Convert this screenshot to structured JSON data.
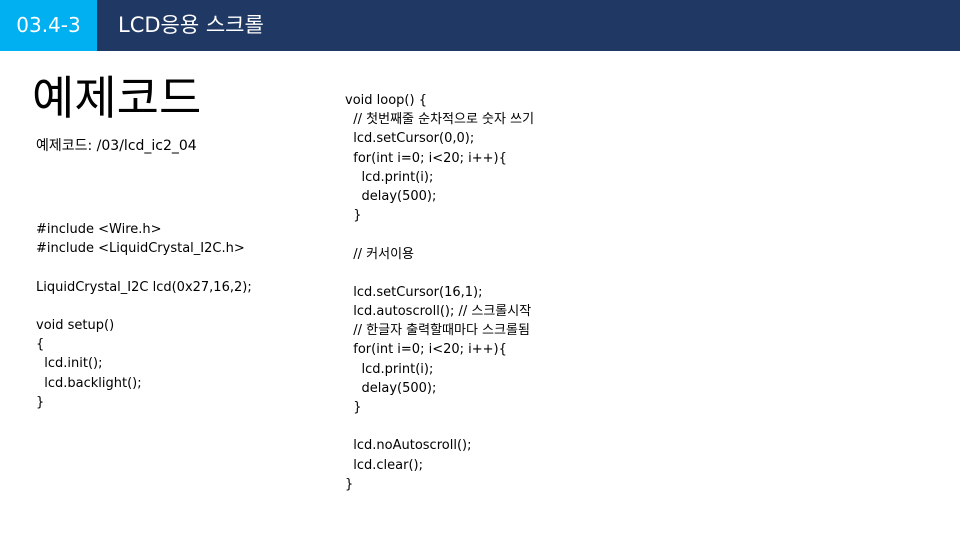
{
  "header": {
    "section_number": "03.4-3",
    "title": "LCD응용 스크롤"
  },
  "page": {
    "title": "예제코드",
    "subtitle": "예제코드: /03/lcd_ic2_04"
  },
  "code_left": [
    "#include <Wire.h>",
    "#include <LiquidCrystal_I2C.h>",
    "",
    "LiquidCrystal_I2C lcd(0x27,16,2);",
    "",
    "void setup()",
    "{",
    "  lcd.init();",
    "  lcd.backlight();",
    "}"
  ],
  "code_right": [
    "void loop() {",
    "  // 첫번째줄 순차적으로 숫자 쓰기",
    "  lcd.setCursor(0,0);",
    "  for(int i=0; i<20; i++){",
    "    lcd.print(i);",
    "    delay(500);",
    "  }",
    "",
    "  // 커서이용",
    "",
    "  lcd.setCursor(16,1);",
    "  lcd.autoscroll(); // 스크롤시작",
    "  // 한글자 출력할때마다 스크롤됨",
    "  for(int i=0; i<20; i++){",
    "    lcd.print(i);",
    "    delay(500);",
    "  }",
    "",
    "  lcd.noAutoscroll();",
    "  lcd.clear();",
    "}"
  ]
}
